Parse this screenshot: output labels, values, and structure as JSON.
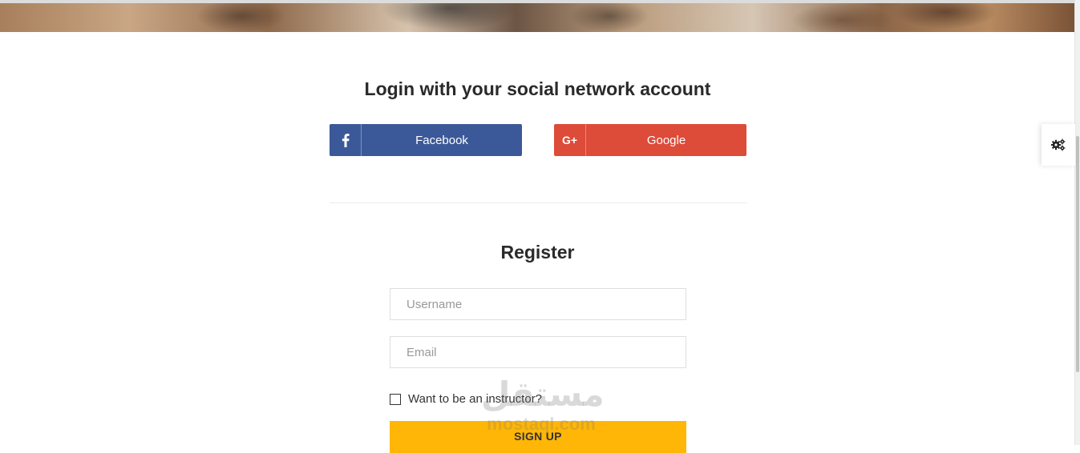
{
  "social": {
    "title": "Login with your social network account",
    "facebook_label": "Facebook",
    "google_label": "Google",
    "google_icon_text": "G+"
  },
  "register": {
    "title": "Register",
    "username_placeholder": "Username",
    "email_placeholder": "Email",
    "instructor_label": "Want to be an instructor?",
    "signup_label": "SIGN UP"
  },
  "watermark": {
    "arabic": "مستقل",
    "latin": "mostaql.com"
  },
  "icons": {
    "facebook": "facebook-icon",
    "google": "google-plus-icon",
    "settings": "gears-icon"
  },
  "colors": {
    "facebook": "#3b5998",
    "google": "#dd4b39",
    "signup": "#ffb606"
  }
}
